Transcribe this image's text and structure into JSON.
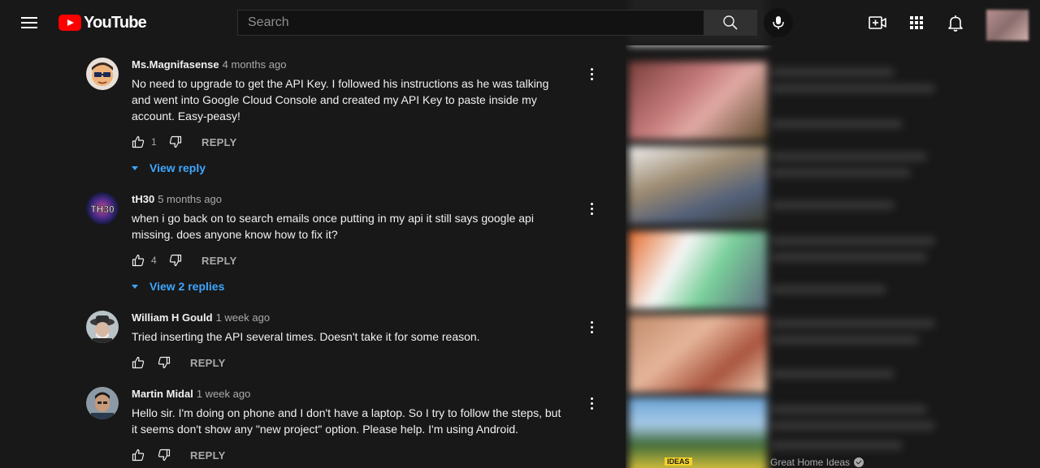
{
  "header": {
    "logo_text": "YouTube",
    "search_placeholder": "Search",
    "icons": [
      "menu-icon",
      "youtube-logo",
      "search-icon",
      "mic-icon",
      "create-video-icon",
      "apps-grid-icon",
      "bell-icon",
      "account-avatar"
    ]
  },
  "colors": {
    "background": "#181818",
    "link_blue": "#3ea6ff",
    "brand_red": "#ff0000",
    "muted_text": "#aaaaaa"
  },
  "comments": [
    {
      "author": "Ms.Magnifasense",
      "time": "4 months ago",
      "text": "No need to upgrade to get the API Key. I followed his instructions as he was talking\nand went into Google Cloud Console and created my API Key to paste inside my\naccount. Easy-peasy!",
      "likes": "1",
      "reply_label": "REPLY",
      "view_replies": "View reply"
    },
    {
      "author": "tH30",
      "time": "5 months ago",
      "text": "when i go back on to search emails once putting in my api it still says google api\nmissing. does anyone know how to fix it?",
      "likes": "4",
      "reply_label": "REPLY",
      "view_replies": "View 2 replies"
    },
    {
      "author": "William H Gould",
      "time": "1 week ago",
      "text": "Tried inserting the API several times. Doesn't take it for some reason.",
      "likes": "",
      "reply_label": "REPLY"
    },
    {
      "author": "Martin Midal",
      "time": "1 week ago",
      "text": "Hello sir. I'm doing on phone and I don't have a laptop. So I try to follow the steps, but\nit seems don't show any \"new project\" option. Please help. I'm using Android.",
      "likes": "",
      "reply_label": "REPLY"
    }
  ],
  "sidebar": {
    "last_channel": "Great Home Ideas",
    "last_thumb_tag": "IDEAS"
  }
}
